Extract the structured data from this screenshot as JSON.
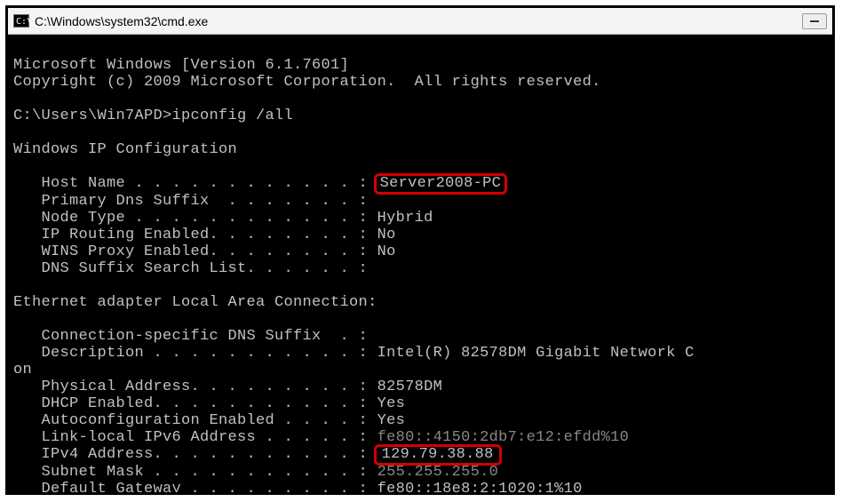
{
  "titlebar": {
    "icon_text": "C:\\.",
    "path": "C:\\Windows\\system32\\cmd.exe"
  },
  "banner": {
    "line1": "Microsoft Windows [Version 6.1.7601]",
    "line2": "Copyright (c) 2009 Microsoft Corporation.  All rights reserved."
  },
  "prompt": {
    "text": "C:\\Users\\Win7APD>",
    "command": "ipconfig /all"
  },
  "ip_config": {
    "header": "Windows IP Configuration",
    "host_name": {
      "label": "   Host Name . . . . . . . . . . . . : ",
      "value": "Server2008-PC"
    },
    "primary_dns_suffix": {
      "label": "   Primary Dns Suffix  . . . . . . . :",
      "value": ""
    },
    "node_type": {
      "label": "   Node Type . . . . . . . . . . . . : ",
      "value": "Hybrid"
    },
    "ip_routing": {
      "label": "   IP Routing Enabled. . . . . . . . : ",
      "value": "No"
    },
    "wins_proxy": {
      "label": "   WINS Proxy Enabled. . . . . . . . : ",
      "value": "No"
    },
    "dns_suffix_list": {
      "label": "   DNS Suffix Search List. . . . . . :",
      "value": ""
    }
  },
  "adapter": {
    "header": "Ethernet adapter Local Area Connection:",
    "conn_dns_suffix": {
      "label": "   Connection-specific DNS Suffix  . :",
      "value": ""
    },
    "description": {
      "label": "   Description . . . . . . . . . . . : ",
      "value": "Intel(R) 82578DM Gigabit Network C",
      "wrap": "on"
    },
    "physical_addr": {
      "label": "   Physical Address. . . . . . . . . : ",
      "value": "82578DM"
    },
    "dhcp_enabled": {
      "label": "   DHCP Enabled. . . . . . . . . . . : ",
      "value": "Yes"
    },
    "autoconfig": {
      "label": "   Autoconfiguration Enabled . . . . : ",
      "value": "Yes"
    },
    "link_local_ipv6": {
      "label": "   Link-local IPv6 Address . . . . . : ",
      "value_obscured": "fe80::4150:2db7:e12:efdd%10"
    },
    "ipv4": {
      "label": "   IPv4 Address. . . . . . . . . . . : ",
      "value": "129.79.38.88"
    },
    "subnet_mask": {
      "label": "   Subnet Mask . . . . . . . . . . . : ",
      "value": "255.255.255.0"
    },
    "default_gateway": {
      "label": "   Default Gateway . . . . . . . . . : ",
      "value": "fe80::18e8:2:1020:1%10"
    }
  },
  "highlights": {
    "host_name": true,
    "ipv4": true
  }
}
